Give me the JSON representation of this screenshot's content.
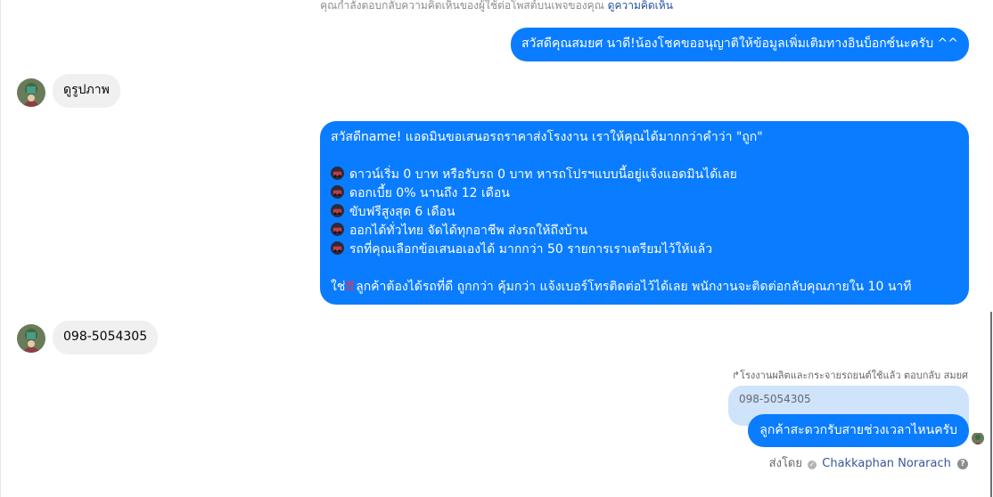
{
  "context_note": {
    "text": "คุณกำลังตอบกลับความคิดเห็นของผู้ใช้ต่อโพสต์บนเพจของคุณ",
    "link": "ดูความคิดเห็น"
  },
  "messages": {
    "greeting": "สวัสดีคุณสมยศ นาดี!น้องโชคขออนุญาติให้ข้อมูลเพิ่มเติมทางอินบ็อกซ์นะครับ ^^",
    "user_photo_request": "ดูรูปภาพ",
    "offer": {
      "intro": "สวัสดีname! แอดมินขอเสนอรถราคาส่งโรงงาน เราให้คุณได้มากกว่าคำว่า \"ถูก\"",
      "bullets": [
        "ดาวน์เริ่ม 0 บาท หรือรับรถ 0 บาท หารถโปรฯแบบนี้อยู่แจ้งแอดมินได้เลย",
        "ดอกเบี้ย 0% นานถึง 12 เดือน",
        "ขับฟรีสูงสุด 6 เดือน",
        "ออกได้ทั่วไทย จัดได้ทุกอาชีพ ส่งรถให้ถึงบ้าน",
        "รถที่คุณเลือกข้อเสนอเองได้ มากกว่า 50 รายการเราเตรียมไว้ให้แล้ว"
      ],
      "closing_prefix": "ใช่",
      "closing_mark": "!!",
      "closing": "ลูกค้าต้องได้รถที่ดี ถูกกว่า คุ้มกว่า แจ้งเบอร์โทรติดต่อไว้ได้เลย พนักงานจะติดต่อกลับคุณภายใน 10 นาที"
    },
    "user_phone": "098-5054305",
    "reply_header": "โรงงานผลิตและกระจายรถยนต์ใช้แล้ว ตอบกลับ สมยศ",
    "quoted_text": "098-5054305",
    "reply": "ลูกค้าสะดวกรับสายช่วงเวลาไหนครับ"
  },
  "sent_by": {
    "prefix": "ส่งโดย",
    "name": "Chakkaphan Norarach",
    "help": "?"
  },
  "colors": {
    "outgoing_bubble": "#0a7cff",
    "incoming_bubble": "#f0f0f0",
    "quoted_bubble": "#cfe3fb"
  }
}
